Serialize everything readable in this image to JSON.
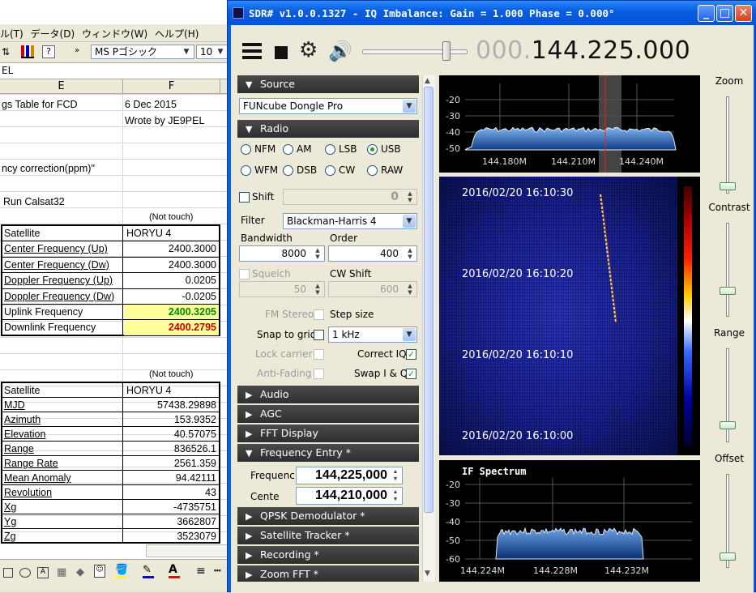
{
  "excel": {
    "menu": [
      "ル(T)",
      "データ(D)",
      "ウィンドウ(W)",
      "ヘルプ(H)"
    ],
    "font_name": "MS Pゴシック",
    "font_size": "10",
    "formula_text": "EL",
    "col_e": "E",
    "col_f": "F",
    "header_title": "gs Table for FCD",
    "header_date": "6 Dec 2015",
    "header_author": "Wrote by JE9PEL",
    "freq_corr": "ncy correction(ppm)\"",
    "run_label": "Run Calsat32",
    "not_touch_1": "(Not touch)",
    "table1": [
      {
        "label": "Satellite",
        "value": "HORYU 4"
      },
      {
        "label": "Center Frequency (Up)",
        "value": "2400.3000"
      },
      {
        "label": "Center Frequency (Dw)",
        "value": "2400.3000"
      },
      {
        "label": "Doppler Frequency (Up)",
        "value": "0.0205"
      },
      {
        "label": "Doppler Frequency (Dw)",
        "value": "-0.0205"
      },
      {
        "label": "Uplink Frequency",
        "value": "2400.3205"
      },
      {
        "label": "Downlink Frequency",
        "value": "2400.2795"
      }
    ],
    "not_touch_2": "(Not touch)",
    "table2": [
      {
        "label": "Satellite",
        "value": "HORYU 4"
      },
      {
        "label": "MJD",
        "value": "57438.29898"
      },
      {
        "label": "Azimuth",
        "value": "153.9352"
      },
      {
        "label": "Elevation",
        "value": "40.57075"
      },
      {
        "label": "Range",
        "value": "836526.1"
      },
      {
        "label": "Range Rate",
        "value": "2561.359"
      },
      {
        "label": "Mean Anomaly",
        "value": "94.42111"
      },
      {
        "label": "Revolution",
        "value": "43"
      },
      {
        "label": "Xg",
        "value": "-4735751"
      },
      {
        "label": "Yg",
        "value": "3662807"
      },
      {
        "label": "Zg",
        "value": "3523079"
      }
    ],
    "uplink_color": "#008800",
    "downlink_color": "#cc0000",
    "highlight_color": "#ffff99"
  },
  "sdr": {
    "title": "SDR# v1.0.0.1327 - IQ Imbalance: Gain = 1.000 Phase = 0.000°",
    "freq_dim": "000.",
    "freq_main": "144.225.000",
    "volume_level": 0.8,
    "sections": {
      "source": "Source",
      "radio": "Radio",
      "audio": "Audio",
      "agc": "AGC",
      "fft": "FFT Display",
      "freq_entry": "Frequency Entry *",
      "qpsk": "QPSK Demodulator *",
      "sat": "Satellite Tracker *",
      "rec": "Recording *",
      "zoomfft": "Zoom FFT *"
    },
    "source_device": "FUNcube Dongle Pro",
    "modes": [
      "NFM",
      "AM",
      "LSB",
      "USB",
      "WFM",
      "DSB",
      "CW",
      "RAW"
    ],
    "selected_mode": "USB",
    "shift_label": "Shift",
    "shift_value": "0",
    "filter_label": "Filter",
    "filter_value": "Blackman-Harris 4",
    "bandwidth_label": "Bandwidth",
    "bandwidth_value": "8000",
    "order_label": "Order",
    "order_value": "400",
    "squelch_label": "Squelch",
    "cwshift_label": "CW Shift",
    "squelch_value": "50",
    "cwshift_value": "600",
    "fmstereo_label": "FM Stereo",
    "stepsize_label": "Step size",
    "snap_label": "Snap to grid",
    "step_value": "1 kHz",
    "lock_label": "Lock carrier",
    "correctiq_label": "Correct IQ",
    "antifading_label": "Anti-Fading",
    "swapiq_label": "Swap I & Q",
    "freq_label": "Frequenc",
    "center_label": "Cente",
    "freq_value": "144,225,000",
    "center_value": "144,210,000",
    "spectrum": {
      "yticks": [
        "-20",
        "-30",
        "-40",
        "-50"
      ],
      "xticks": [
        "144.180M",
        "144.210M",
        "144.240M"
      ]
    },
    "waterfall_times": [
      "2016/02/20 16:10:30",
      "2016/02/20 16:10:20",
      "2016/02/20 16:10:10",
      "2016/02/20 16:10:00"
    ],
    "if_spectrum": {
      "title": "IF Spectrum",
      "yticks": [
        "-20",
        "-30",
        "-40",
        "-50",
        "-60"
      ],
      "xticks": [
        "144.224M",
        "144.228M",
        "144.232M"
      ]
    },
    "sliders": {
      "zoom": "Zoom",
      "contrast": "Contrast",
      "range": "Range",
      "offset": "Offset"
    },
    "accent_color": "#0a5ee0"
  }
}
